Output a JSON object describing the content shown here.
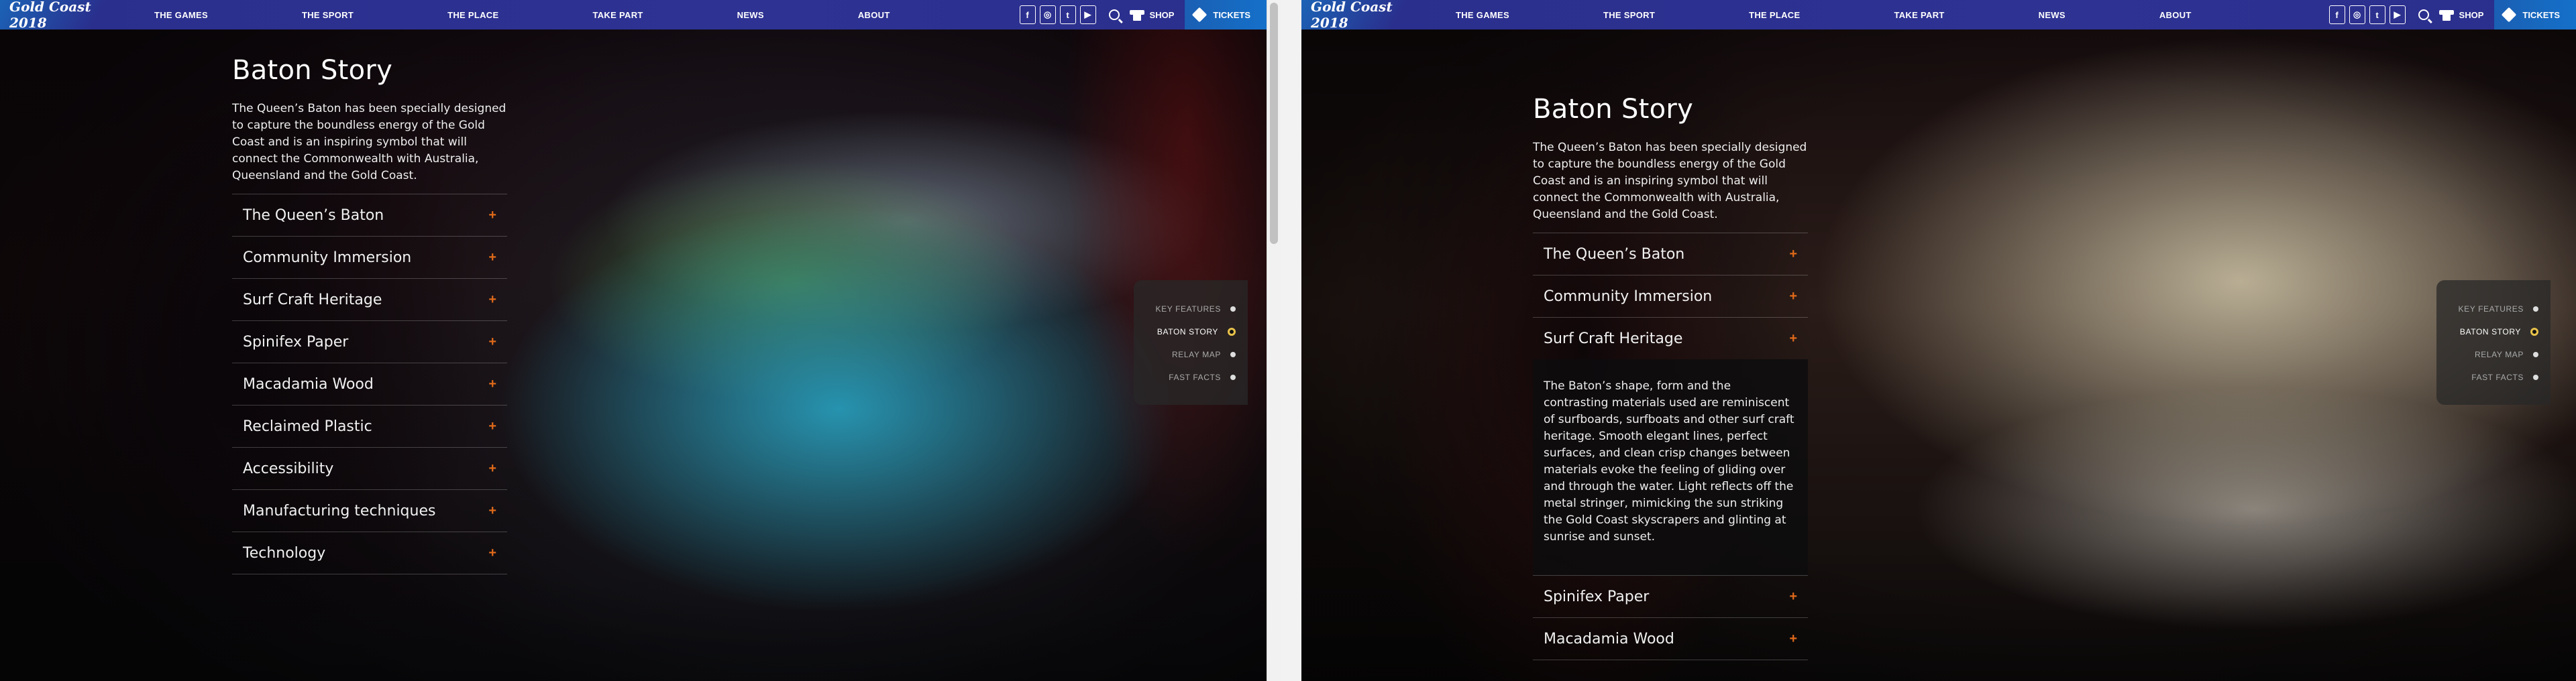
{
  "nav": {
    "logo": "Gold Coast 2018",
    "links": [
      "THE GAMES",
      "THE SPORT",
      "THE PLACE",
      "TAKE PART",
      "NEWS",
      "ABOUT"
    ],
    "social": [
      "f",
      "◎",
      "t",
      "▶"
    ],
    "shop": "SHOP",
    "tickets": "TICKETS"
  },
  "page": {
    "title": "Baton Story",
    "intro": "The Queen’s Baton has been specially designed to capture the boundless energy of the Gold Coast and is an inspiring symbol that will connect the Commonwealth with Australia, Queensland and the Gold Coast."
  },
  "accordion": {
    "items": [
      "The Queen’s Baton",
      "Community Immersion",
      "Surf Craft Heritage",
      "Spinifex Paper",
      "Macadamia Wood",
      "Reclaimed Plastic",
      "Accessibility",
      "Manufacturing techniques",
      "Technology"
    ],
    "expanded_text": "The Baton’s shape, form and the contrasting materials used are reminiscent of surfboards, surfboats and other surf craft heritage. Smooth elegant lines, perfect surfaces, and clean crisp changes between materials evoke the feeling of gliding over and through the water. Light reflects off the metal stringer, mimicking the sun striking the Gold Coast skyscrapers and glinting at sunrise and sunset."
  },
  "section_nav": {
    "items": [
      "KEY FEATURES",
      "BATON STORY",
      "RELAY MAP",
      "FAST FACTS"
    ],
    "active": "BATON STORY"
  },
  "colors": {
    "nav_bg": "#2e3293",
    "accent_plus": "#e06a1a",
    "active_dot_ring": "#e8c24a"
  }
}
